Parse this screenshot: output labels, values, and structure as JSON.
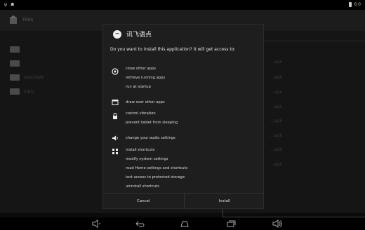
{
  "status_bar": {
    "left_icons": [
      "usb-icon",
      "android-debug-icon"
    ],
    "time": "6:0"
  },
  "background_app": {
    "title": "Files",
    "folders": [
      "",
      "",
      "SYSTEM",
      "DEV"
    ],
    "files": [
      "...apk",
      "...apk",
      "...apk",
      "...apk",
      "...apk",
      "...apk",
      "...apk",
      "...apk"
    ]
  },
  "dialog": {
    "app_name": "讯飞语点",
    "message": "Do you want to install this application? It will get access to:",
    "permission_groups": [
      {
        "icon": "apps-icon",
        "lines": [
          "close other apps",
          "retrieve running apps",
          "run at startup"
        ]
      },
      {
        "icon": "window-icon",
        "lines": [
          "draw over other apps"
        ]
      },
      {
        "icon": "lock-icon",
        "lines": [
          "control vibration",
          "prevent tablet from sleeping"
        ]
      },
      {
        "icon": "speaker-icon",
        "lines": [
          "change your audio settings"
        ]
      },
      {
        "icon": "shortcut-icon",
        "lines": [
          "install shortcuts",
          "modify system settings",
          "read Home settings and shortcuts",
          "test access to protected storage",
          "uninstall shortcuts"
        ]
      }
    ],
    "buttons": {
      "cancel": "Cancel",
      "install": "Install"
    }
  },
  "nav_bar": {
    "icons": [
      "volume-down-icon",
      "back-icon",
      "home-icon",
      "recent-apps-icon",
      "volume-up-icon"
    ]
  }
}
